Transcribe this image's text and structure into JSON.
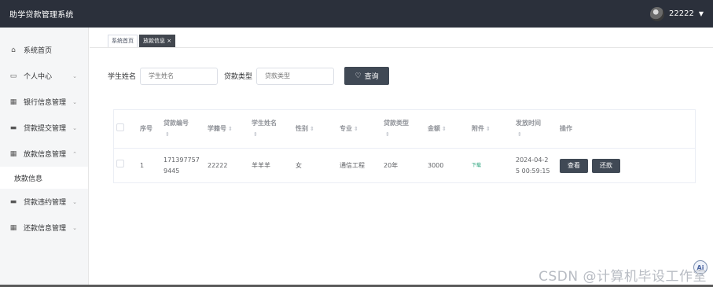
{
  "app": {
    "title": "助学贷款管理系统"
  },
  "user": {
    "name": "22222",
    "caret": "▼"
  },
  "sidebar": {
    "items": [
      {
        "label": "系统首页",
        "icon": "⌂"
      },
      {
        "label": "个人中心",
        "icon": "▭"
      },
      {
        "label": "银行信息管理",
        "icon": "▦"
      },
      {
        "label": "贷款提交管理",
        "icon": "▬"
      },
      {
        "label": "放款信息管理",
        "icon": "▦"
      },
      {
        "label": "贷款违约管理",
        "icon": "▬"
      },
      {
        "label": "还款信息管理",
        "icon": "▦"
      }
    ],
    "sub_item": "放款信息",
    "chevron_down": "⌄",
    "chevron_up": "⌃"
  },
  "tabs": [
    {
      "label": "系统首页"
    },
    {
      "label": "放款信息 ×"
    }
  ],
  "search": {
    "name_label": "学生姓名",
    "name_placeholder": "学生姓名",
    "type_label": "贷款类型",
    "type_placeholder": "贷款类型",
    "button_label": "查询",
    "button_icon": "♡"
  },
  "table": {
    "headers": {
      "index": "序号",
      "loan_no": "贷款编号",
      "student_no": "学籍号",
      "student_name": "学生姓名",
      "gender": "性别",
      "major": "专业",
      "loan_type": "贷款类型",
      "amount": "金额",
      "attachment": "附件",
      "issue_time": "发放时间",
      "actions": "操作"
    },
    "sort_icon": "⇕",
    "rows": [
      {
        "index": "1",
        "loan_no_line1": "171397757",
        "loan_no_line2": "9445",
        "student_no": "22222",
        "student_name": "羊羊羊",
        "gender": "女",
        "major": "通信工程",
        "loan_type": "20年",
        "amount": "3000",
        "attachment": "下载",
        "issue_time_line1": "2024-04-2",
        "issue_time_line2": "5 00:59:15",
        "view_label": "查看",
        "repay_label": "还款"
      }
    ]
  },
  "watermark": "CSDN @计算机毕设工作室",
  "ai_badge": "Ai",
  "colors": {
    "topbar": "#2b303b",
    "button": "#404955",
    "download": "#27a27a"
  }
}
